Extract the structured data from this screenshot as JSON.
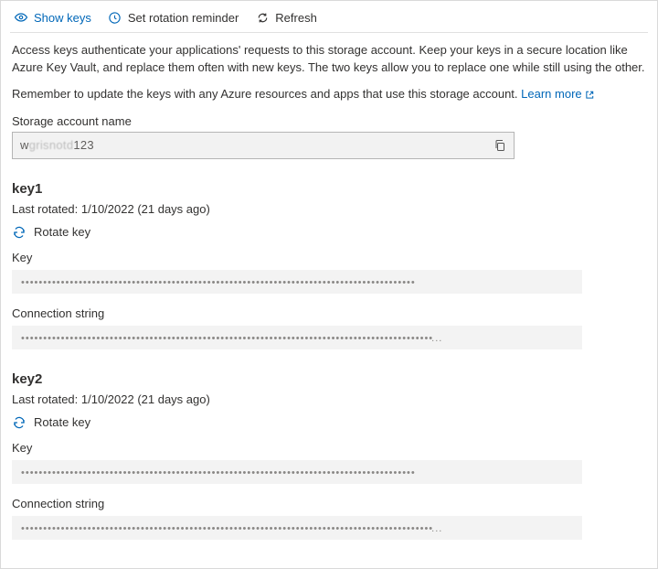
{
  "toolbar": {
    "show_keys": "Show keys",
    "set_rotation_reminder": "Set rotation reminder",
    "refresh": "Refresh"
  },
  "description": {
    "line1": "Access keys authenticate your applications' requests to this storage account. Keep your keys in a secure location like Azure Key Vault, and replace them often with new keys. The two keys allow you to replace one while still using the other.",
    "line2_prefix": "Remember to update the keys with any Azure resources and apps that use this storage account. ",
    "learn_more": "Learn more"
  },
  "storage_account": {
    "label": "Storage account name",
    "value_prefix": "w",
    "value_blur": "grisnotd",
    "value_suffix": "123"
  },
  "keys": [
    {
      "title": "key1",
      "last_rotated": "Last rotated: 1/10/2022 (21 days ago)",
      "rotate_label": "Rotate key",
      "key_label": "Key",
      "key_masked": "•••••••••••••••••••••••••••••••••••••••••••••••••••••••••••••••••••••••••••••••••••••••••",
      "conn_label": "Connection string",
      "conn_masked": "•••••••••••••••••••••••••••••••••••••••••••••••••••••••••••••••••••••••••••••••••••••••••••••"
    },
    {
      "title": "key2",
      "last_rotated": "Last rotated: 1/10/2022 (21 days ago)",
      "rotate_label": "Rotate key",
      "key_label": "Key",
      "key_masked": "•••••••••••••••••••••••••••••••••••••••••••••••••••••••••••••••••••••••••••••••••••••••••",
      "conn_label": "Connection string",
      "conn_masked": "•••••••••••••••••••••••••••••••••••••••••••••••••••••••••••••••••••••••••••••••••••••••••••••"
    }
  ]
}
